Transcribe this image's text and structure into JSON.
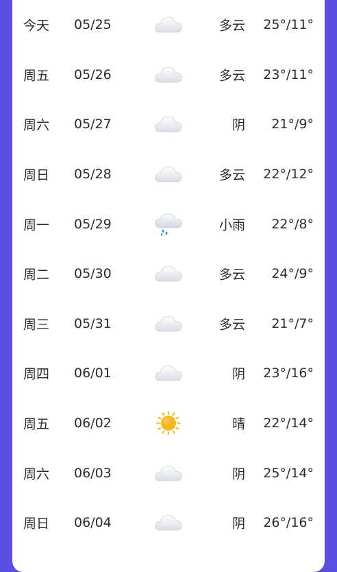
{
  "forecast": [
    {
      "day": "今天",
      "date": "05/25",
      "icon": "cloud-icon",
      "condition": "多云",
      "temp": "25°/11°"
    },
    {
      "day": "周五",
      "date": "05/26",
      "icon": "cloud-icon",
      "condition": "多云",
      "temp": "23°/11°"
    },
    {
      "day": "周六",
      "date": "05/27",
      "icon": "cloud-icon",
      "condition": "阴",
      "temp": "21°/9°"
    },
    {
      "day": "周日",
      "date": "05/28",
      "icon": "cloud-icon",
      "condition": "多云",
      "temp": "22°/12°"
    },
    {
      "day": "周一",
      "date": "05/29",
      "icon": "light-rain-icon",
      "condition": "小雨",
      "temp": "22°/8°"
    },
    {
      "day": "周二",
      "date": "05/30",
      "icon": "cloud-icon",
      "condition": "多云",
      "temp": "24°/9°"
    },
    {
      "day": "周三",
      "date": "05/31",
      "icon": "cloud-icon",
      "condition": "多云",
      "temp": "21°/7°"
    },
    {
      "day": "周四",
      "date": "06/01",
      "icon": "cloud-icon",
      "condition": "阴",
      "temp": "23°/16°"
    },
    {
      "day": "周五",
      "date": "06/02",
      "icon": "sun-icon",
      "condition": "晴",
      "temp": "22°/14°"
    },
    {
      "day": "周六",
      "date": "06/03",
      "icon": "cloud-icon",
      "condition": "阴",
      "temp": "25°/14°"
    },
    {
      "day": "周日",
      "date": "06/04",
      "icon": "cloud-icon",
      "condition": "阴",
      "temp": "26°/16°"
    }
  ],
  "colors": {
    "background": "#5b4fe0",
    "card": "#ffffff",
    "text": "#2b2b2b",
    "sun": "#f5b81c",
    "rain": "#3a8de0"
  }
}
